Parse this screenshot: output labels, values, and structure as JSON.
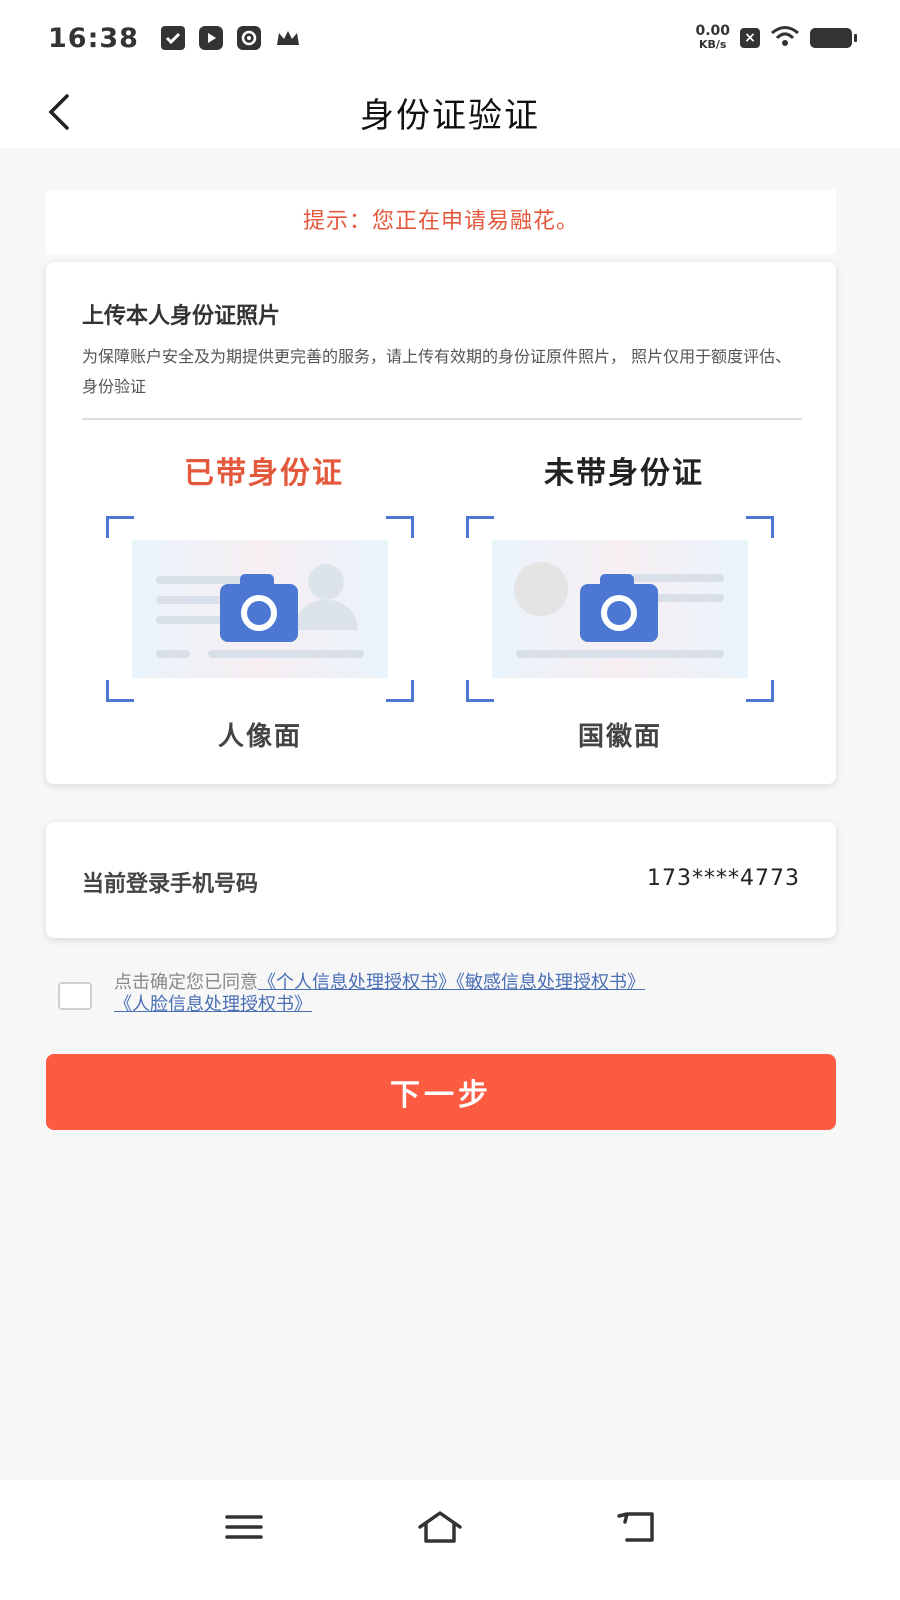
{
  "status_bar": {
    "time": "16:38",
    "net_speed_value": "0.00",
    "net_speed_unit": "KB/s",
    "icons": [
      "notification-check-icon",
      "youtube-icon",
      "camera-app-icon",
      "crown-icon",
      "close-notify-icon",
      "wifi-icon",
      "battery-icon"
    ]
  },
  "nav": {
    "title": "身份证验证",
    "back_icon": "chevron-left-icon"
  },
  "notice": {
    "text": "提示：您正在申请易融花。"
  },
  "upload": {
    "title": "上传本人身份证照片",
    "description": "为保障账户安全及为期提供更完善的服务，请上传有效期的身份证原件照片， 照片仅用于额度评估、身份验证",
    "with_id_label": "已带身份证",
    "without_id_label": "未带身份证",
    "portrait_side_label": "人像面",
    "emblem_side_label": "国徽面"
  },
  "phone": {
    "label": "当前登录手机号码",
    "value": "173****4773"
  },
  "agreement": {
    "prefix": "点击确定您已同意",
    "link_personal": "《个人信息处理授权书》",
    "link_sensitive": "《敏感信息处理授权书》",
    "link_face": "《人脸信息处理授权书》",
    "checked": false
  },
  "next_button": {
    "label": "下一步"
  },
  "colors": {
    "accent": "#fb5b40",
    "notice_text": "#e4583c",
    "camera_blue": "#4c78d4",
    "link": "#4a6fb5"
  }
}
